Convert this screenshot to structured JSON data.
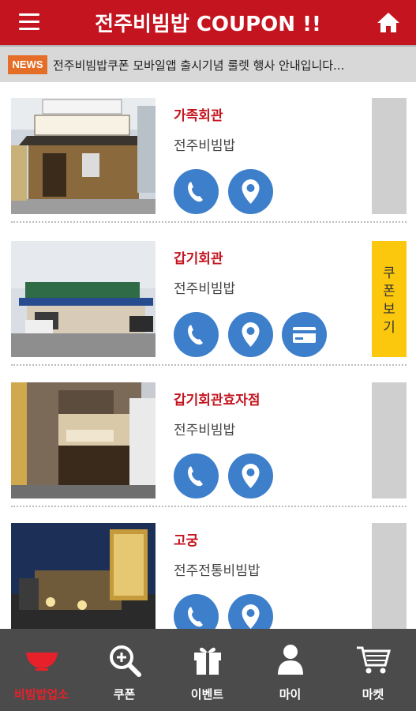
{
  "header": {
    "title": "전주비빔밥 COUPON !!"
  },
  "news": {
    "badge": "NEWS",
    "text": "전주비빔밥쿠폰 모바일앱 출시기념 룰렛 행사 안내입니다..."
  },
  "stores": [
    {
      "name": "가족회관",
      "category": "전주비빔밥",
      "actions": [
        "phone-icon",
        "map-pin-icon"
      ]
    },
    {
      "name": "갑기회관",
      "category": "전주비빔밥",
      "actions": [
        "phone-icon",
        "map-pin-icon",
        "card-icon"
      ],
      "coupon_label": "쿠폰보기"
    },
    {
      "name": "갑기회관효자점",
      "category": "전주비빔밥",
      "actions": [
        "phone-icon",
        "map-pin-icon"
      ]
    },
    {
      "name": "고궁",
      "category": "전주전통비빔밥",
      "actions": [
        "phone-icon",
        "map-pin-icon"
      ]
    }
  ],
  "coupon_chars": [
    "쿠",
    "폰",
    "보",
    "기"
  ],
  "tabs": [
    {
      "label": "비빔밥업소",
      "icon": "bowl-icon",
      "active": true
    },
    {
      "label": "쿠폰",
      "icon": "zoom-in-icon"
    },
    {
      "label": "이벤트",
      "icon": "gift-icon"
    },
    {
      "label": "마이",
      "icon": "person-icon"
    },
    {
      "label": "마켓",
      "icon": "cart-icon"
    }
  ],
  "colors": {
    "header_red": "#c4141f",
    "news_badge": "#e46e28",
    "action_blue": "#3d7fcb",
    "coupon_yellow": "#fbc80d",
    "tabbar": "#4b4b4b",
    "active_tab_label": "#e8202a"
  }
}
